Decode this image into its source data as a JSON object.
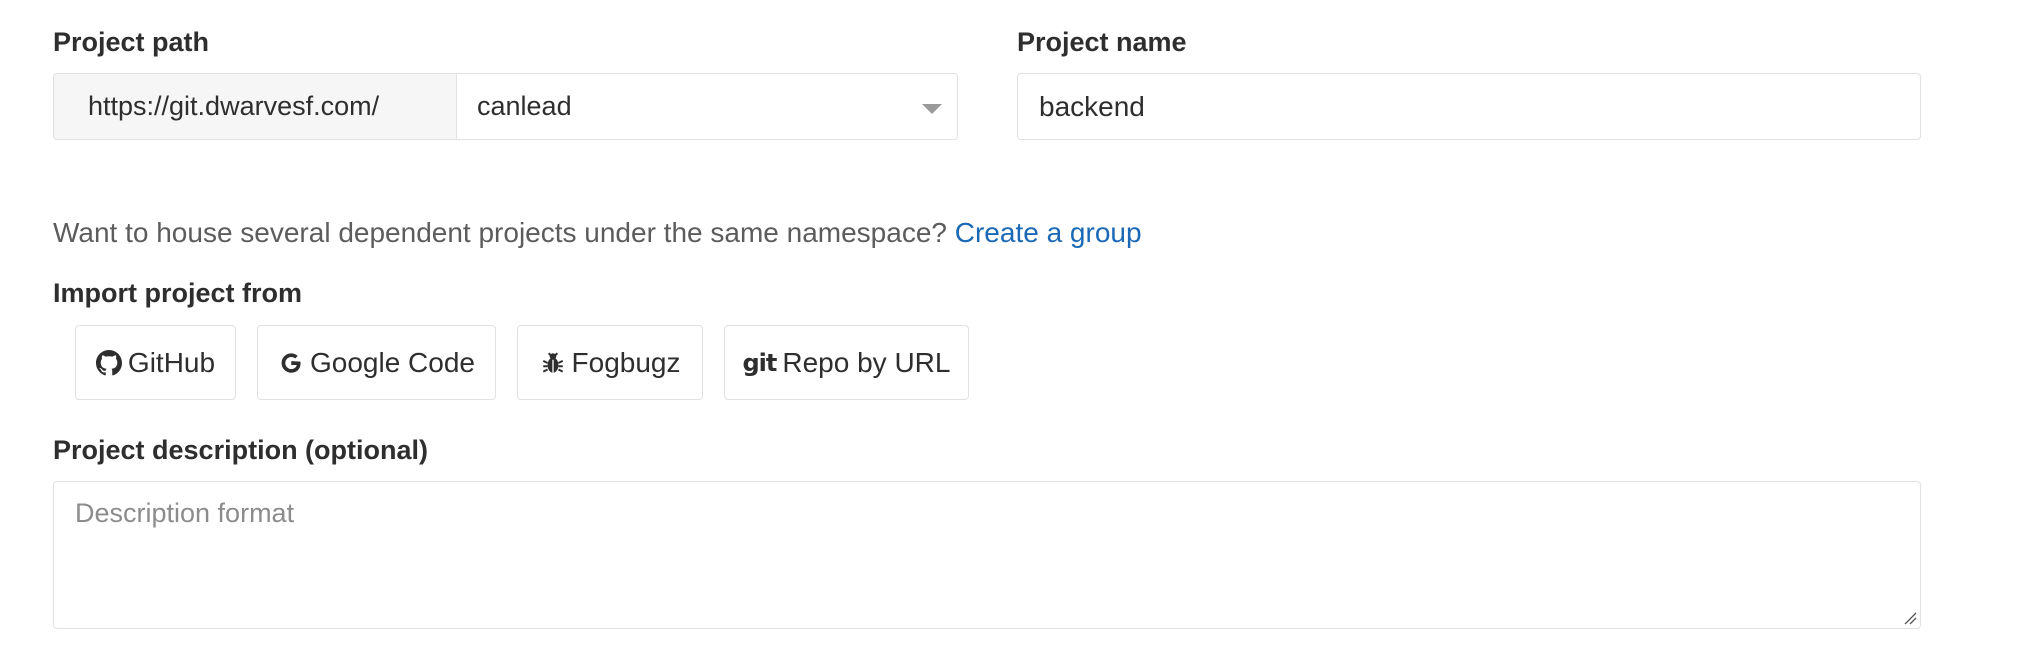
{
  "project_path": {
    "label": "Project path",
    "prefix": "https://git.dwarvesf.com/",
    "namespace_value": "canlead"
  },
  "project_name": {
    "label": "Project name",
    "value": "backend"
  },
  "group_help": {
    "text": "Want to house several dependent projects under the same namespace? ",
    "link": "Create a group"
  },
  "import": {
    "label": "Import project from",
    "buttons": [
      {
        "label": "GitHub",
        "icon": "github-icon"
      },
      {
        "label": "Google Code",
        "icon": "google-icon"
      },
      {
        "label": "Fogbugz",
        "icon": "bug-icon"
      },
      {
        "label": "Repo by URL",
        "icon": "git-icon",
        "icon_text": "git"
      }
    ]
  },
  "description": {
    "label": "Project description (optional)",
    "placeholder": "Description format"
  },
  "colors": {
    "link": "#1b69b6",
    "border": "#e1e1e1",
    "addon_bg": "#f6f6f6"
  }
}
